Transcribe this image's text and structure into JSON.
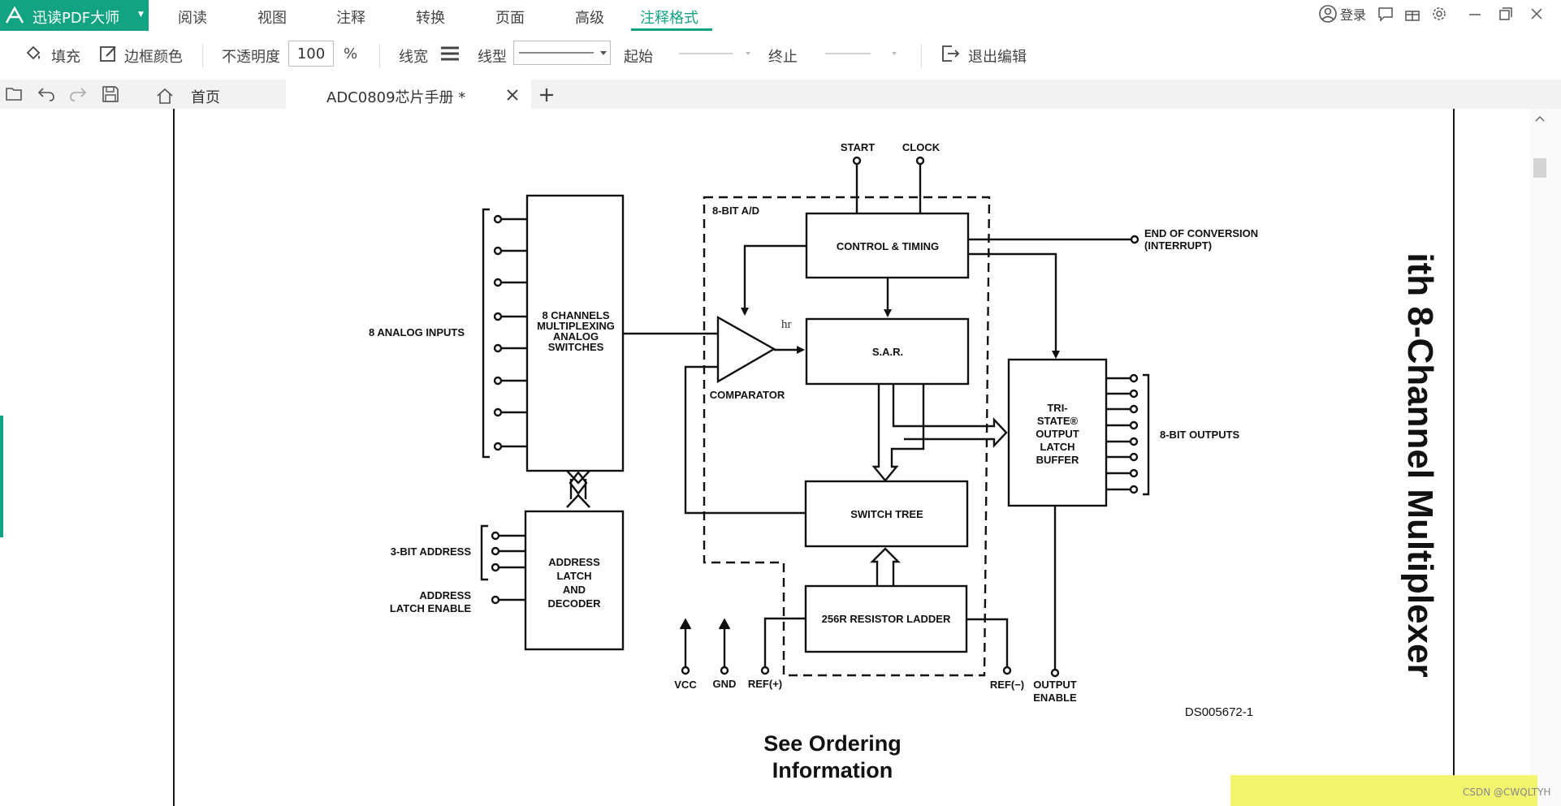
{
  "brand": {
    "name": "迅读PDF大师"
  },
  "menu": {
    "items": [
      "阅读",
      "视图",
      "注释",
      "转换",
      "页面",
      "高级",
      "注释格式"
    ]
  },
  "topright": {
    "login": "登录"
  },
  "toolbar": {
    "fill": "填充",
    "border_color": "边框颜色",
    "opacity_label": "不透明度",
    "opacity_value": "100",
    "percent": "%",
    "line_width": "线宽",
    "line_type": "线型",
    "start": "起始",
    "end": "终止",
    "exit": "退出编辑"
  },
  "tabs": {
    "home": "首页",
    "doc": "ADC0809芯片手册 *"
  },
  "document": {
    "vertical_title": "ith 8-Channel Multiplexer",
    "ordering_line1": "See Ordering",
    "ordering_line2": "Information",
    "figure_id": "DS005672-1",
    "handwritten": "hr"
  },
  "diagram": {
    "start": "START",
    "clock": "CLOCK",
    "adc_label": "8-BIT A/D",
    "control_timing": "CONTROL & TIMING",
    "eoc_line1": "END OF CONVERSION",
    "eoc_line2": "(INTERRUPT)",
    "analog_inputs": "8 ANALOG INPUTS",
    "mux_lines": [
      "8 CHANNELS",
      "MULTIPLEXING",
      "ANALOG",
      "SWITCHES"
    ],
    "sar": "S.A.R.",
    "comparator": "COMPARATOR",
    "tristate_lines": [
      "TRI-",
      "STATE®",
      "OUTPUT",
      "LATCH",
      "BUFFER"
    ],
    "outputs": "8-BIT OUTPUTS",
    "switch_tree": "SWITCH TREE",
    "address_3bit": "3-BIT ADDRESS",
    "ale_line1": "ADDRESS",
    "ale_line2": "LATCH ENABLE",
    "decoder_lines": [
      "ADDRESS",
      "LATCH",
      "AND",
      "DECODER"
    ],
    "ladder": "256R RESISTOR LADDER",
    "vcc": "VCC",
    "gnd": "GND",
    "ref_plus": "REF(+)",
    "ref_minus": "REF(−)",
    "oe_line1": "OUTPUT",
    "oe_line2": "ENABLE"
  },
  "watermark": {
    "csdn": "CSDN @CWQLTYH"
  },
  "colors": {
    "accent": "#12a482",
    "highlight": "#f3f56f"
  }
}
